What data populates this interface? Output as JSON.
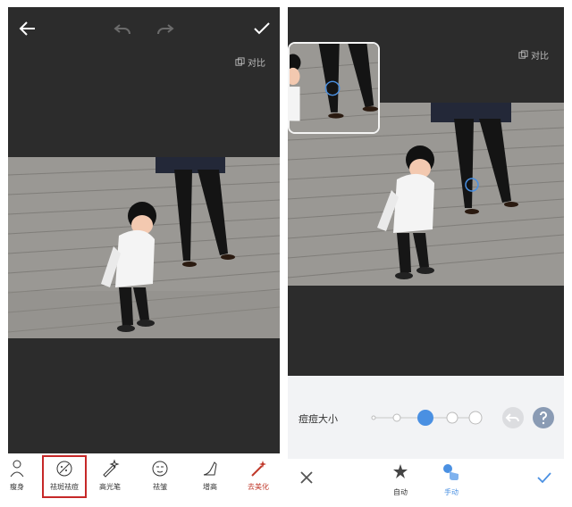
{
  "left_screen": {
    "compare_label": "对比",
    "tools": [
      {
        "label": "瘦身",
        "icon": "body-slim-icon"
      },
      {
        "label": "祛斑祛痘",
        "icon": "blemish-remove-icon"
      },
      {
        "label": "高光笔",
        "icon": "highlight-pen-icon"
      },
      {
        "label": "祛皱",
        "icon": "wrinkle-remove-icon"
      },
      {
        "label": "增高",
        "icon": "heightening-icon"
      },
      {
        "label": "去美化",
        "icon": "magic-wand-icon"
      }
    ],
    "selected_tool": "祛斑祛痘"
  },
  "right_screen": {
    "compare_label": "对比",
    "size_label": "痘痘大小",
    "size_levels": 5,
    "size_selected_index": 2,
    "modes": [
      {
        "label": "自动",
        "icon": "auto-star-icon"
      },
      {
        "label": "手动",
        "icon": "manual-finger-icon"
      }
    ],
    "active_mode": "手动"
  },
  "colors": {
    "accent_blue": "#4a90e2",
    "selected_outline": "#c62828",
    "dark_bg": "#2c2c2c",
    "active_red": "#c0392b"
  }
}
